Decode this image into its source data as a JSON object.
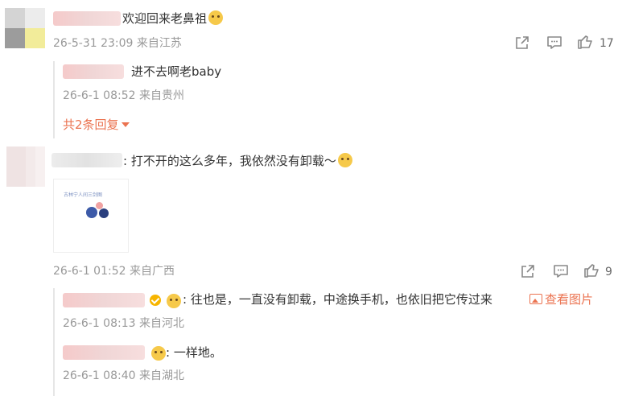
{
  "comments": [
    {
      "text": "欢迎回来老鼻祖",
      "time": "26-5-31 23:09",
      "location": "来自江苏",
      "likes": "17",
      "replies": [
        {
          "text": "进不去啊老baby",
          "time": "26-6-1 08:52",
          "location": "来自贵州"
        }
      ],
      "more_replies_label": "共2条回复"
    },
    {
      "text": ": 打不开的这么多年，我依然没有卸载～",
      "image_caption": "古林宁人间三剑图",
      "time": "26-6-1 01:52",
      "location": "来自广西",
      "likes": "9",
      "replies": [
        {
          "text": ": 往也是，一直没有卸载，中途换手机，也依旧把它传过来",
          "view_pic_label": "查看图片",
          "time": "26-6-1 08:13",
          "location": "来自河北"
        },
        {
          "text": ": 一样地。",
          "time": "26-6-1 08:40",
          "location": "来自湖北"
        }
      ]
    }
  ],
  "icons": {
    "share": "share-icon",
    "comment": "comment-icon",
    "like": "thumbs-up-icon"
  },
  "colors": {
    "accent": "#eb7350",
    "meta": "#999999",
    "text": "#333333"
  }
}
